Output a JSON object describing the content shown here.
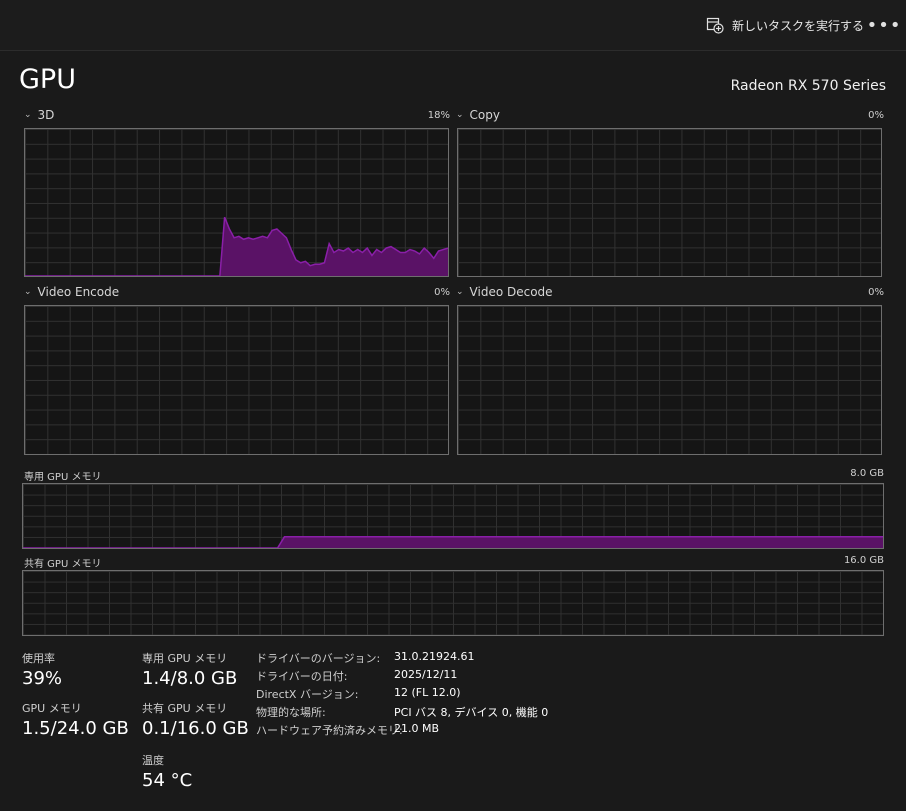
{
  "header": {
    "run_task_label": "新しいタスクを実行する",
    "run_task_icon": "run-task-icon",
    "more_icon": "more-options-icon",
    "more_label": "•••"
  },
  "page": {
    "title": "GPU",
    "device": "Radeon RX 570 Series"
  },
  "colors": {
    "accent": "#8a1fa8",
    "accent_fill": "#5a1266",
    "grid": "#313131",
    "border": "#6e6e6e",
    "background": "#1a1a1a"
  },
  "engines": [
    {
      "name": "3D",
      "percent": "18%",
      "history": [
        0,
        0,
        0,
        0,
        0,
        0,
        0,
        0,
        0,
        0,
        0,
        0,
        0,
        0,
        0,
        0,
        0,
        0,
        0,
        0,
        0,
        0,
        0,
        0,
        0,
        0,
        0,
        0,
        0,
        0,
        0,
        0,
        0,
        0,
        0,
        0,
        0,
        0,
        0,
        0,
        0,
        0,
        40,
        32,
        26,
        27,
        25,
        26,
        25,
        26,
        27,
        26,
        31,
        32,
        29,
        26,
        18,
        11,
        9,
        10,
        7,
        8,
        8,
        9,
        22,
        16,
        18,
        17,
        19,
        16,
        18,
        16,
        19,
        14,
        18,
        16,
        19,
        20,
        18,
        16,
        16,
        18,
        17,
        15,
        19,
        16,
        12,
        17,
        18,
        19
      ]
    },
    {
      "name": "Copy",
      "percent": "0%",
      "history": []
    },
    {
      "name": "Video Encode",
      "percent": "0%",
      "history": []
    },
    {
      "name": "Video Decode",
      "percent": "0%",
      "history": []
    }
  ],
  "dedicated_memory": {
    "label": "専用 GPU メモリ",
    "max": "8.0 GB",
    "history_gb": [
      0,
      0,
      0,
      0,
      0,
      0,
      0,
      0,
      0,
      0,
      0,
      0,
      0,
      0,
      0,
      0,
      0,
      0,
      0,
      0,
      0,
      0,
      0,
      0,
      0,
      0,
      0,
      0,
      0,
      0,
      0,
      0,
      0,
      0,
      0,
      0,
      0,
      0,
      1.4,
      1.4,
      1.4,
      1.4,
      1.4,
      1.4,
      1.4,
      1.4,
      1.4,
      1.4,
      1.4,
      1.4,
      1.4,
      1.4,
      1.4,
      1.4,
      1.4,
      1.4,
      1.4,
      1.4,
      1.4,
      1.4,
      1.4,
      1.4,
      1.4,
      1.4,
      1.4,
      1.4,
      1.4,
      1.4,
      1.4,
      1.4,
      1.4,
      1.4,
      1.4,
      1.4,
      1.4,
      1.4,
      1.4,
      1.4,
      1.4,
      1.4,
      1.4,
      1.4,
      1.4,
      1.4,
      1.4,
      1.4,
      1.4,
      1.4,
      1.4,
      1.4,
      1.4,
      1.4,
      1.4,
      1.4,
      1.4,
      1.4,
      1.4,
      1.4,
      1.4,
      1.4,
      1.4,
      1.4,
      1.4,
      1.4,
      1.4,
      1.4,
      1.4,
      1.4,
      1.4,
      1.4,
      1.4,
      1.4,
      1.4,
      1.4,
      1.4,
      1.4,
      1.4,
      1.4,
      1.4,
      1.4,
      1.4,
      1.4,
      1.4,
      1.4,
      1.4,
      1.4
    ],
    "max_gb": 8
  },
  "shared_memory": {
    "label": "共有 GPU メモリ",
    "max": "16.0 GB",
    "history_gb": [],
    "max_gb": 16
  },
  "stats": {
    "utilization_label": "使用率",
    "utilization_value": "39%",
    "dedicated_label": "専用 GPU メモリ",
    "dedicated_value": "1.4/8.0 GB",
    "gpu_memory_label": "GPU メモリ",
    "gpu_memory_value": "1.5/24.0 GB",
    "shared_label": "共有 GPU メモリ",
    "shared_value": "0.1/16.0 GB",
    "temperature_label": "温度",
    "temperature_value": "54 °C"
  },
  "info": [
    {
      "key": "ドライバーのバージョン:",
      "value": "31.0.21924.61"
    },
    {
      "key": "ドライバーの日付:",
      "value": "2025/12/11"
    },
    {
      "key": "DirectX バージョン:",
      "value": "12 (FL 12.0)"
    },
    {
      "key": "物理的な場所:",
      "value": "PCI バス 8, デバイス 0, 機能 0"
    },
    {
      "key": "ハードウェア予約済みメモリ:",
      "value": "21.0 MB"
    }
  ]
}
